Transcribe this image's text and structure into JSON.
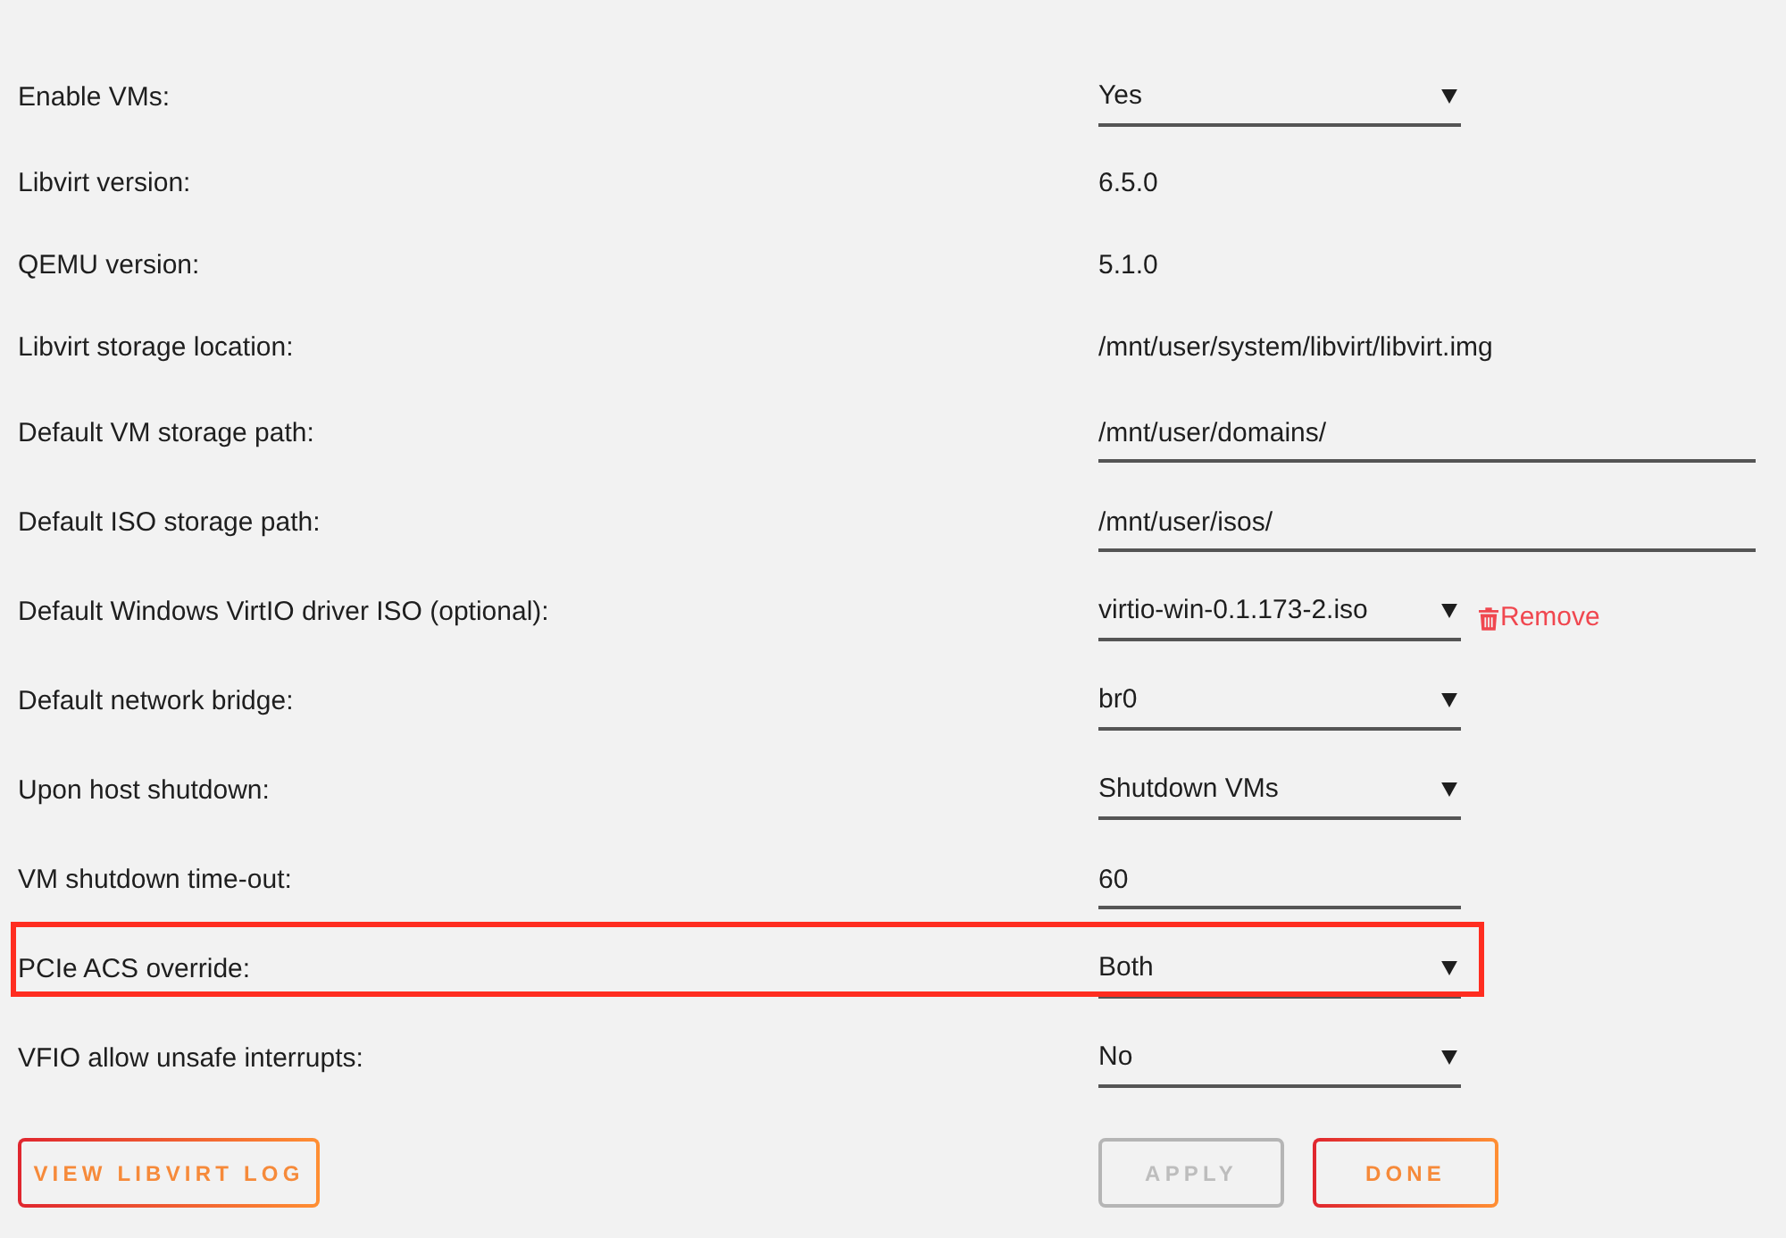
{
  "settings": [
    {
      "label": "Enable VMs:",
      "kind": "select",
      "value": "Yes",
      "highlighted": false
    },
    {
      "label": "Libvirt version:",
      "kind": "text",
      "value": "6.5.0",
      "highlighted": false
    },
    {
      "label": "QEMU version:",
      "kind": "text",
      "value": "5.1.0",
      "highlighted": false
    },
    {
      "label": "Libvirt storage location:",
      "kind": "text",
      "value": "/mnt/user/system/libvirt/libvirt.img",
      "highlighted": false
    },
    {
      "label": "Default VM storage path:",
      "kind": "input",
      "value": "/mnt/user/domains/",
      "highlighted": false
    },
    {
      "label": "Default ISO storage path:",
      "kind": "input",
      "value": "/mnt/user/isos/",
      "highlighted": false
    },
    {
      "label": "Default Windows VirtIO driver ISO (optional):",
      "kind": "select",
      "value": "virtio-win-0.1.173-2.iso",
      "action": "Remove",
      "highlighted": false
    },
    {
      "label": "Default network bridge:",
      "kind": "select",
      "value": "br0",
      "highlighted": false
    },
    {
      "label": "Upon host shutdown:",
      "kind": "select",
      "value": "Shutdown VMs",
      "highlighted": false
    },
    {
      "label": "VM shutdown time-out:",
      "kind": "input-short",
      "value": "60",
      "highlighted": false
    },
    {
      "label": "PCIe ACS override:",
      "kind": "select",
      "value": "Both",
      "highlighted": true
    },
    {
      "label": "VFIO allow unsafe interrupts:",
      "kind": "select",
      "value": "No",
      "highlighted": false
    }
  ],
  "log_button": {
    "label": "VIEW LIBVIRT LOG",
    "disabled": false
  },
  "form_buttons": [
    {
      "label": "APPLY",
      "disabled": true
    },
    {
      "label": "DONE",
      "disabled": false
    }
  ]
}
